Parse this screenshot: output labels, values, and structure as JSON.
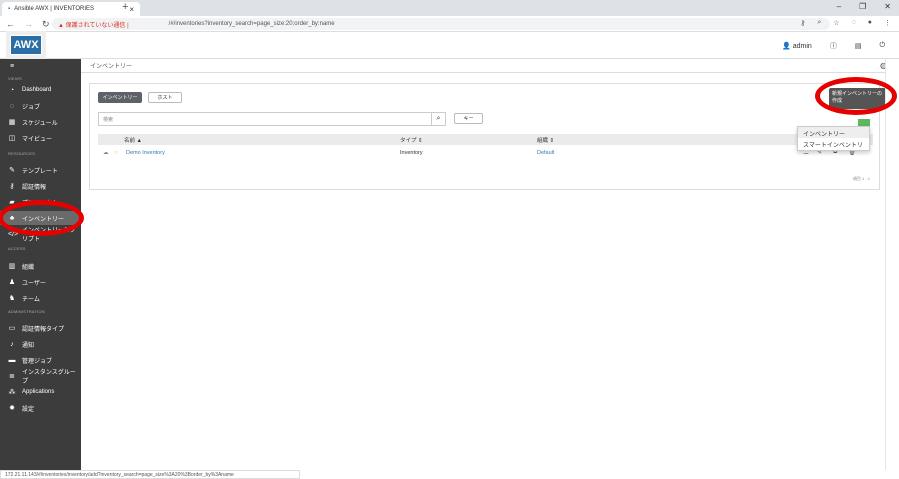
{
  "browser": {
    "tab_title": "Ansible AWX | INVENTORIES",
    "warning": "保護されていない通信",
    "url": "/#/inventories?inventory_search=page_size:20;order_by:name",
    "status_url": "172.21.11.143/#/inventories/inventory/add?inventory_search=page_size%3A20%3Border_by%3Aname"
  },
  "header": {
    "logo": "AWX",
    "user": "admin"
  },
  "breadcrumb": "インベントリー",
  "sidebar": {
    "sections": {
      "views": "VIEWS",
      "resources": "RESOURCES",
      "access": "ACCESS",
      "admin": "ADMINISTRATION"
    },
    "items": [
      {
        "label": "Dashboard",
        "icon": "dashboard-icon"
      },
      {
        "label": "ジョブ",
        "icon": "jobs-icon"
      },
      {
        "label": "スケジュール",
        "icon": "calendar-icon"
      },
      {
        "label": "マイビュー",
        "icon": "columns-icon"
      },
      {
        "label": "テンプレート",
        "icon": "template-icon"
      },
      {
        "label": "認証情報",
        "icon": "key-icon"
      },
      {
        "label": "プロジェクト",
        "icon": "folder-icon"
      },
      {
        "label": "インベントリー",
        "icon": "sitemap-icon"
      },
      {
        "label": "インベントリースクリプト",
        "icon": "code-icon"
      },
      {
        "label": "組織",
        "icon": "building-icon"
      },
      {
        "label": "ユーザー",
        "icon": "user-icon"
      },
      {
        "label": "チーム",
        "icon": "users-icon"
      },
      {
        "label": "認証情報タイプ",
        "icon": "id-card-icon"
      },
      {
        "label": "通知",
        "icon": "bell-icon"
      },
      {
        "label": "管理ジョブ",
        "icon": "briefcase-icon"
      },
      {
        "label": "インスタンスグループ",
        "icon": "server-icon"
      },
      {
        "label": "Applications",
        "icon": "cubes-icon"
      },
      {
        "label": "設定",
        "icon": "cog-icon"
      }
    ]
  },
  "main": {
    "tabs": [
      "インベントリー",
      "ホスト"
    ],
    "search_placeholder": "検索",
    "key_button": "キー",
    "columns": [
      "名前 ▲",
      "タイプ ⇕",
      "組織 ⇕"
    ],
    "rows": [
      {
        "name": "Demo Inventory",
        "type": "Inventory",
        "org": "Default"
      }
    ],
    "tooltip": "新規インベントリーの作成",
    "dropdown": [
      "インベントリー",
      "スマートインベントリー"
    ],
    "pager": "項目 1 - 1"
  }
}
